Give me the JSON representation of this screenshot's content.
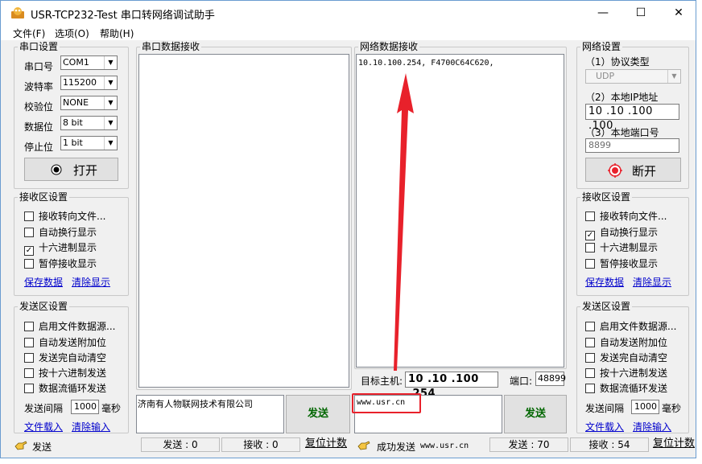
{
  "window": {
    "title": "USR-TCP232-Test 串口转网络调试助手",
    "minimize_glyph": "—",
    "maximize_glyph": "☐",
    "close_glyph": "✕"
  },
  "menu": [
    "文件(F)",
    "选项(O)",
    "帮助(H)"
  ],
  "serial_settings": {
    "legend": "串口设置",
    "rows": [
      {
        "label": "串口号",
        "value": "COM1"
      },
      {
        "label": "波特率",
        "value": "115200"
      },
      {
        "label": "校验位",
        "value": "NONE"
      },
      {
        "label": "数据位",
        "value": "8 bit"
      },
      {
        "label": "停止位",
        "value": "1 bit"
      }
    ],
    "open_button": "打开"
  },
  "left_receive": {
    "legend": "接收区设置",
    "options": [
      {
        "label": "接收转向文件...",
        "checked": false
      },
      {
        "label": "自动换行显示",
        "checked": false
      },
      {
        "label": "十六进制显示",
        "checked": true
      },
      {
        "label": "暂停接收显示",
        "checked": false
      }
    ],
    "save_link": "保存数据",
    "clear_link": "清除显示"
  },
  "left_send": {
    "legend": "发送区设置",
    "options": [
      {
        "label": "启用文件数据源...",
        "checked": false
      },
      {
        "label": "自动发送附加位",
        "checked": false
      },
      {
        "label": "发送完自动清空",
        "checked": false
      },
      {
        "label": "按十六进制发送",
        "checked": false
      },
      {
        "label": "数据流循环发送",
        "checked": false
      }
    ],
    "interval_label": "发送间隔",
    "interval_value": "1000",
    "interval_unit": "毫秒",
    "load_link": "文件载入",
    "clear_link": "清除输入"
  },
  "serial_receive": {
    "legend": "串口数据接收",
    "content": ""
  },
  "network_receive": {
    "legend": "网络数据接收",
    "content": "10.10.100.254, F4700C64C620,"
  },
  "target": {
    "host_label": "目标主机:",
    "host_value": "10 .10 .100 .254",
    "port_label": "端口:",
    "port_value": "48899"
  },
  "serial_send": {
    "text": "济南有人物联网技术有限公司",
    "button": "发送"
  },
  "network_send": {
    "text": "www.usr.cn",
    "button": "发送"
  },
  "network_settings": {
    "legend": "网络设置",
    "protocol_label": "（1）协议类型",
    "protocol_value": "UDP",
    "local_ip_label": "（2）本地IP地址",
    "local_ip_value": "10 .10 .100 .100",
    "local_port_label": "（3）本地端口号",
    "local_port_value": "8899",
    "disconnect_button": "断开"
  },
  "right_receive": {
    "legend": "接收区设置",
    "options": [
      {
        "label": "接收转向文件...",
        "checked": false
      },
      {
        "label": "自动换行显示",
        "checked": true
      },
      {
        "label": "十六进制显示",
        "checked": false
      },
      {
        "label": "暂停接收显示",
        "checked": false
      }
    ],
    "save_link": "保存数据",
    "clear_link": "清除显示"
  },
  "right_send": {
    "legend": "发送区设置",
    "options": [
      {
        "label": "启用文件数据源...",
        "checked": false
      },
      {
        "label": "自动发送附加位",
        "checked": false
      },
      {
        "label": "发送完自动清空",
        "checked": false
      },
      {
        "label": "按十六进制发送",
        "checked": false
      },
      {
        "label": "数据流循环发送",
        "checked": false
      }
    ],
    "interval_label": "发送间隔",
    "interval_value": "1000",
    "interval_unit": "毫秒",
    "load_link": "文件载入",
    "clear_link": "清除输入"
  },
  "status_left": {
    "text": "发送",
    "send_count": "发送 : 0",
    "recv_count": "接收 : 0",
    "reset": "复位计数"
  },
  "status_right": {
    "text": "成功发送",
    "address": "www.usr.cn",
    "send_count": "发送 : 70",
    "recv_count": "接收 : 54",
    "reset": "复位计数"
  },
  "colors": {
    "accent_red": "#e8212b",
    "send_green": "#006600",
    "link_blue": "#0000cc"
  },
  "icons": [
    "app-icon",
    "radio-icon",
    "red-target-icon",
    "hand-icon",
    "arrow-annotation-icon"
  ]
}
